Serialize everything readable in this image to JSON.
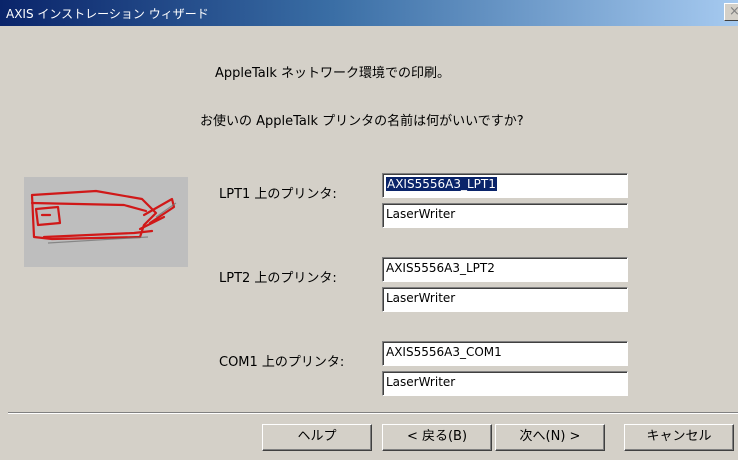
{
  "window": {
    "title": "AXIS インストレーション ウィザード",
    "close_label": "×"
  },
  "content": {
    "intro": "AppleTalk ネットワーク環境での印刷。",
    "question": "お使いの AppleTalk プリンタの名前は何がいいですか?"
  },
  "printers": [
    {
      "label": "LPT1 上のプリンタ:",
      "name": "AXIS5556A3_LPT1",
      "type": "LaserWriter"
    },
    {
      "label": "LPT2 上のプリンタ:",
      "name": "AXIS5556A3_LPT2",
      "type": "LaserWriter"
    },
    {
      "label": "COM1 上のプリンタ:",
      "name": "AXIS5556A3_COM1",
      "type": "LaserWriter"
    }
  ],
  "buttons": {
    "help": "ヘルプ",
    "back": "< 戻る(B)",
    "next": "次へ(N) >",
    "cancel": "キャンセル"
  },
  "colors": {
    "dialog_bg": "#d4d0c8",
    "titlebar_start": "#0a246a",
    "titlebar_end": "#a6caf0",
    "selection": "#0a246a",
    "printer_sketch": "#d01818"
  }
}
